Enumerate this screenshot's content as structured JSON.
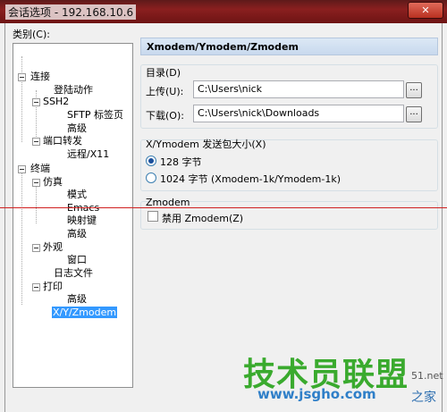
{
  "window": {
    "title": "会话选项 - 192.168.10.6",
    "close_label": "✕"
  },
  "category_label": "类别(C):",
  "tree": [
    {
      "label": "连接"
    },
    {
      "label": "登陆动作"
    },
    {
      "label": "SSH2"
    },
    {
      "label": "SFTP 标签页"
    },
    {
      "label": "高级"
    },
    {
      "label": "端口转发"
    },
    {
      "label": "远程/X11"
    },
    {
      "label": "终端"
    },
    {
      "label": "仿真"
    },
    {
      "label": "模式"
    },
    {
      "label": "Emacs"
    },
    {
      "label": "映射键"
    },
    {
      "label": "高级"
    },
    {
      "label": "外观"
    },
    {
      "label": "窗口"
    },
    {
      "label": "日志文件"
    },
    {
      "label": "打印"
    },
    {
      "label": "高级"
    },
    {
      "label": "X/Y/Zmodem",
      "selected": true
    }
  ],
  "panel": {
    "header": "Xmodem/Ymodem/Zmodem",
    "directories": {
      "title": "目录(D)",
      "upload_label": "上传(U):",
      "upload_value": "C:\\Users\\nick",
      "download_label": "下载(O):",
      "download_value": "C:\\Users\\nick\\Downloads",
      "browse_label": "..."
    },
    "packet": {
      "title": "X/Ymodem 发送包大小(X)",
      "option1": "128 字节",
      "option2": "1024 字节  (Xmodem-1k/Ymodem-1k)",
      "selected": "128 字节"
    },
    "zmodem": {
      "title": "Zmodem",
      "disable_label": "禁用 Zmodem(Z)",
      "checked": false
    }
  },
  "watermark": {
    "main": "技术员联盟",
    "url": "www.jsgho.com",
    "side_top": "51.net",
    "side_bottom": "之家"
  },
  "colors": {
    "accent": "#3399ff",
    "titlebar": "#8a1f1f",
    "panel_header": "#c8d9ee",
    "redline": "#d02020"
  }
}
